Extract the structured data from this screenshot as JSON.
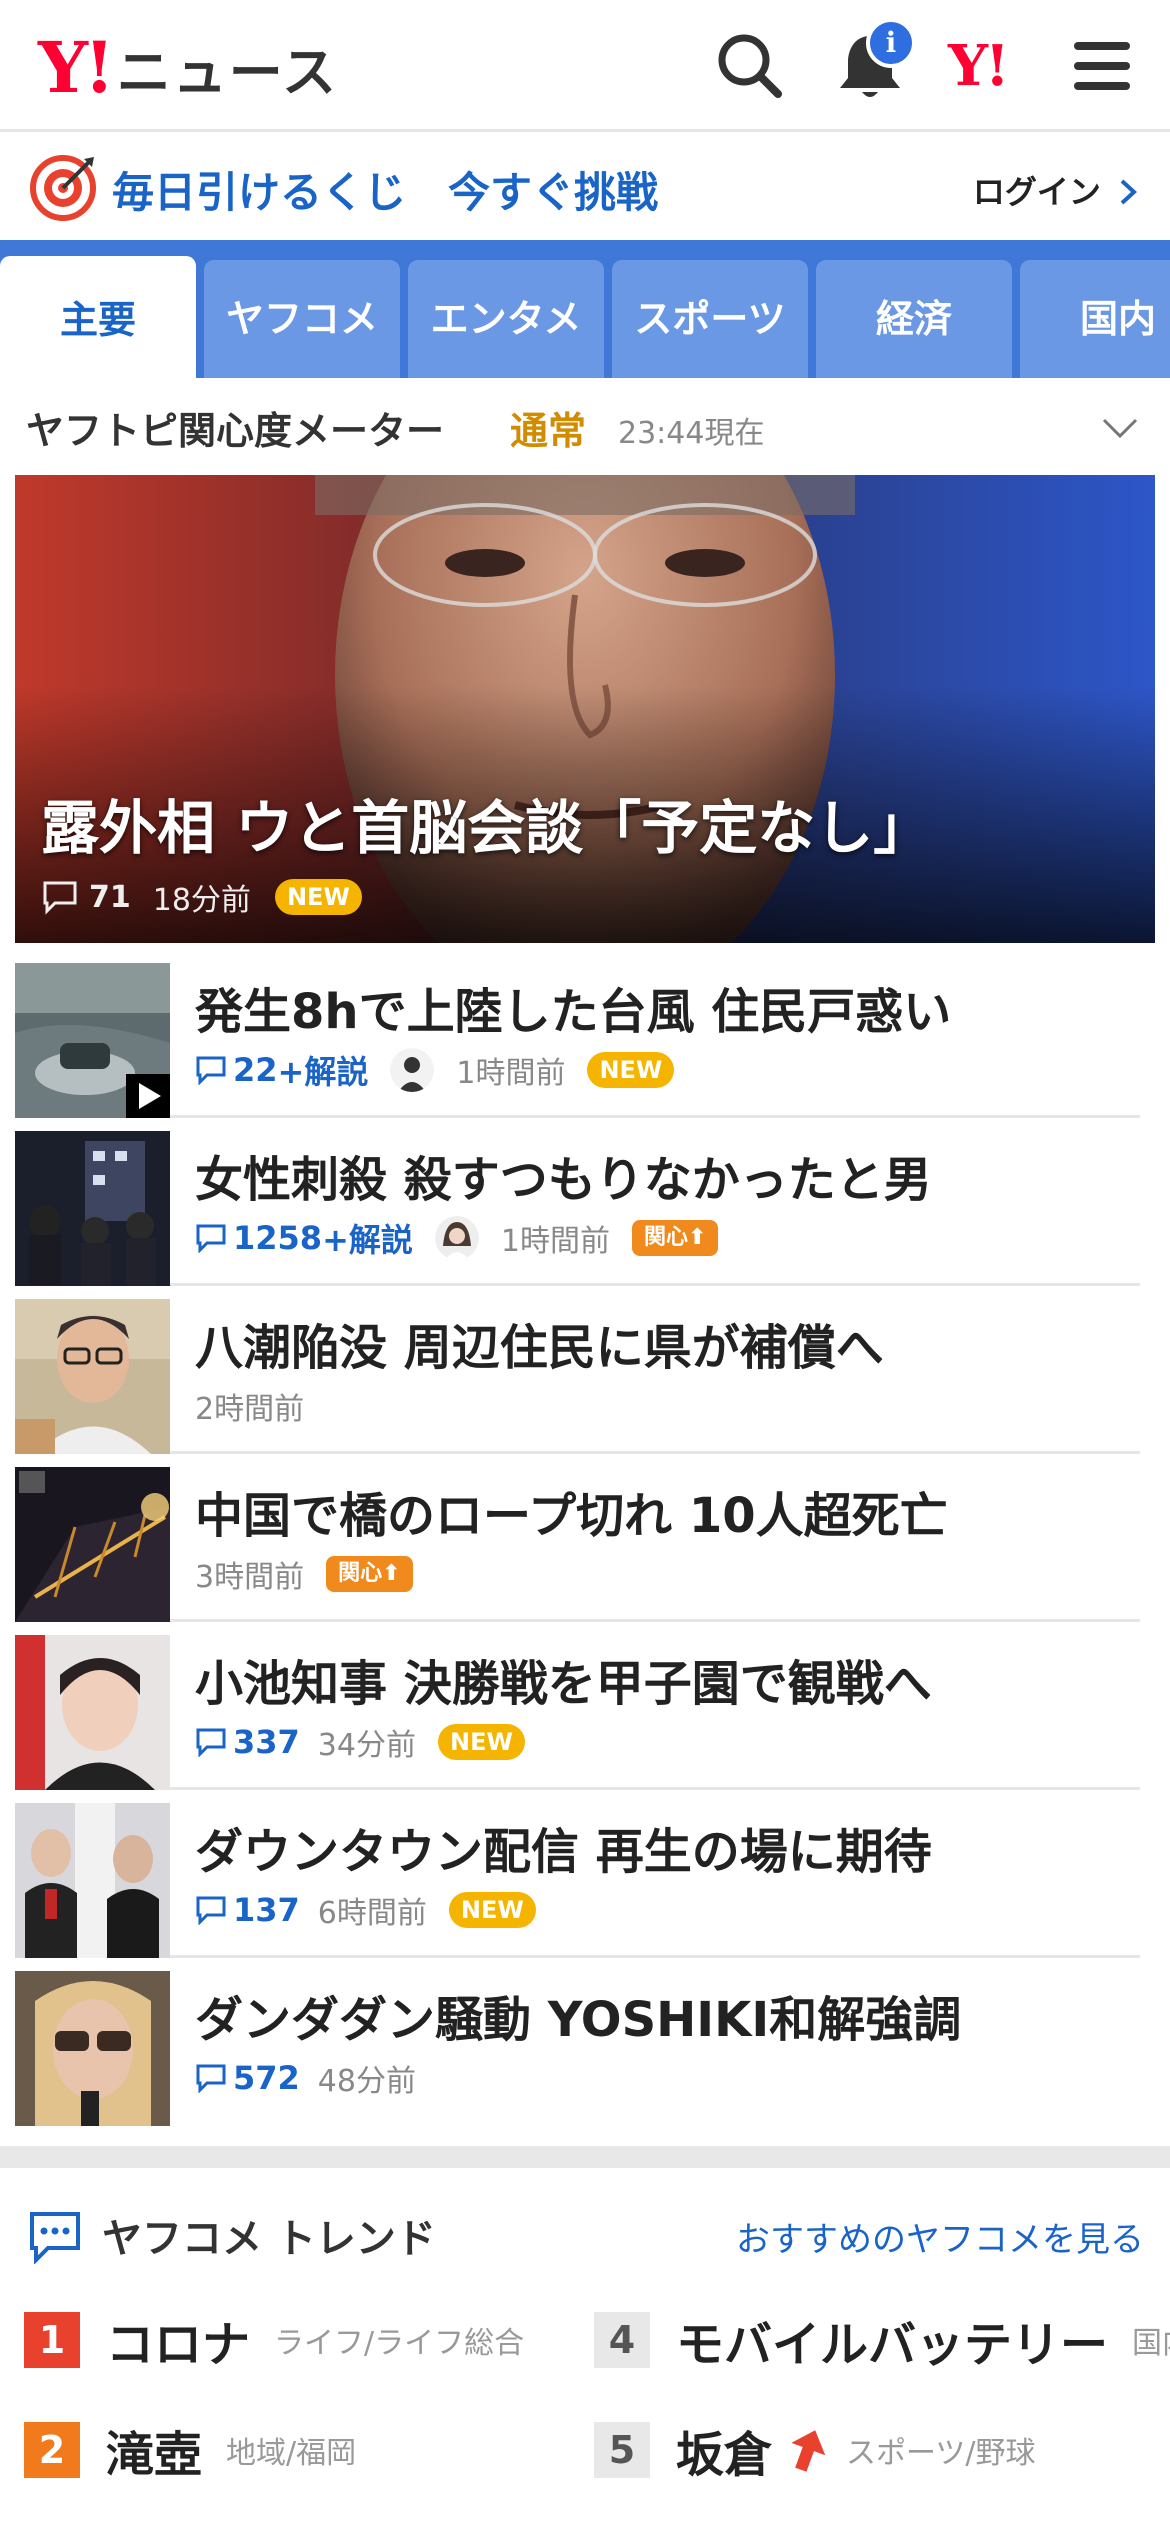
{
  "header": {
    "logo_mark": "Y!",
    "logo_text": "ニュース",
    "notification_badge": "i",
    "yahoo_mark": "Y!"
  },
  "lottery": {
    "text": "毎日引けるくじ　今すぐ挑戦",
    "login": "ログイン"
  },
  "tabs": [
    {
      "label": "主要",
      "active": true
    },
    {
      "label": "ヤフコメ"
    },
    {
      "label": "エンタメ"
    },
    {
      "label": "スポーツ"
    },
    {
      "label": "経済"
    },
    {
      "label": "国内"
    }
  ],
  "meter": {
    "title": "ヤフトピ関心度メーター",
    "status": "通常",
    "time": "23:44現在"
  },
  "top_story": {
    "headline": "露外相 ウと首脳会談「予定なし」",
    "comments": "71",
    "time": "18分前",
    "badge": "NEW"
  },
  "articles": [
    {
      "title": "発生8hで上陸した台風 住民戸惑い",
      "comments": "22",
      "extra": "+解説",
      "time": "1時間前",
      "badge": "NEW"
    },
    {
      "title": "女性刺殺 殺すつもりなかったと男",
      "comments": "1258",
      "extra": "+解説",
      "time": "1時間前",
      "badge": "関心"
    },
    {
      "title": "八潮陥没 周辺住民に県が補償へ",
      "time": "2時間前"
    },
    {
      "title": "中国で橋のロープ切れ 10人超死亡",
      "time": "3時間前",
      "badge": "関心"
    },
    {
      "title": "小池知事 決勝戦を甲子園で観戦へ",
      "comments": "337",
      "time": "34分前",
      "badge": "NEW"
    },
    {
      "title": "ダウンタウン配信 再生の場に期待",
      "comments": "137",
      "time": "6時間前",
      "badge": "NEW"
    },
    {
      "title": "ダンダダン騒動 YOSHIKI和解強調",
      "comments": "572",
      "time": "48分前"
    }
  ],
  "trend": {
    "title": "ヤフコメ トレンド",
    "link": "おすすめのヤフコメを見る",
    "items": [
      {
        "rank": "1",
        "word": "コロナ",
        "category": "ライフ/ライフ総合"
      },
      {
        "rank": "2",
        "word": "滝壺",
        "category": "地域/福岡"
      },
      {
        "rank": "4",
        "word": "モバイルバッテリー",
        "category": "国内"
      },
      {
        "rank": "5",
        "word": "坂倉",
        "category": "スポーツ/野球"
      }
    ]
  },
  "colors": {
    "brand_red": "#ff0033",
    "link_blue": "#1a64c8",
    "tab_blue": "#3f78d6",
    "new_badge": "#f5b400",
    "kanshin_badge": "#f08a1c",
    "meter_status": "#d18c00"
  },
  "icons": [
    "search-icon",
    "bell-icon",
    "menu-icon",
    "target-icon",
    "chevron-right-icon",
    "chevron-down-icon",
    "comment-icon",
    "play-icon",
    "trend-comment-icon",
    "arrow-up-icon"
  ]
}
